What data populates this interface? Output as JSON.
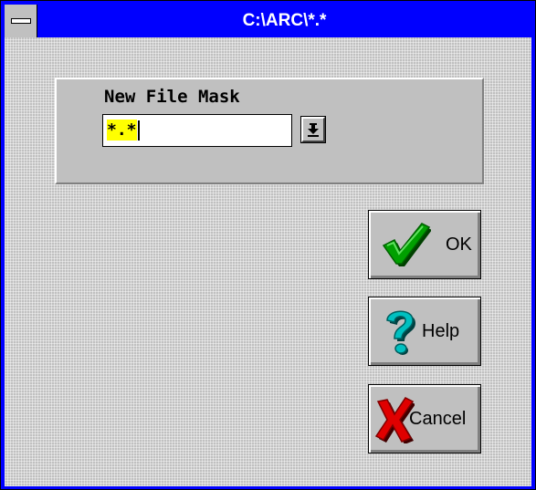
{
  "window": {
    "title": "C:\\ARC\\*.*"
  },
  "group": {
    "label": "New File Mask"
  },
  "mask_input": {
    "value": "*.*"
  },
  "buttons": {
    "ok": {
      "label": "OK",
      "icon": "checkmark-icon"
    },
    "help": {
      "label": "Help",
      "icon": "question-mark-icon"
    },
    "cancel": {
      "label": "Cancel",
      "icon": "x-mark-icon"
    }
  },
  "colors": {
    "titlebar": "#0000ff",
    "face": "#c0c0c0",
    "selection": "#ffff00"
  }
}
